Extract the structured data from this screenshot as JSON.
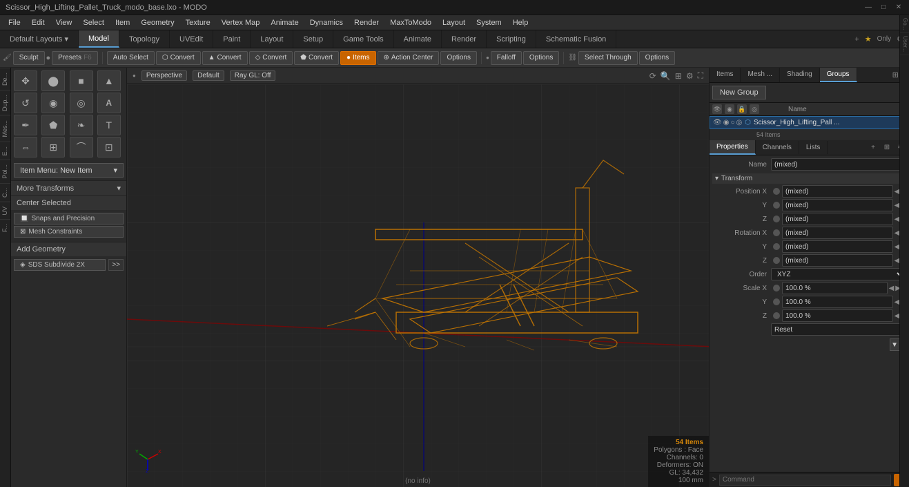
{
  "titlebar": {
    "title": "Scissor_High_Lifting_Pallet_Truck_modo_base.lxo - MODO",
    "minimize": "—",
    "maximize": "□",
    "close": "✕"
  },
  "menubar": {
    "items": [
      "File",
      "Edit",
      "View",
      "Select",
      "Item",
      "Geometry",
      "Texture",
      "Vertex Map",
      "Animate",
      "Dynamics",
      "Render",
      "MaxToModo",
      "Layout",
      "System",
      "Help"
    ]
  },
  "main_tabs": {
    "items": [
      "Default Layouts ▾",
      "Model",
      "Topology",
      "UVEdit",
      "Paint",
      "Layout",
      "Setup",
      "Game Tools",
      "Animate",
      "Render",
      "Scripting",
      "Schematic Fusion"
    ],
    "active": "Model",
    "plus": "+",
    "star": "★",
    "only_label": "Only",
    "settings_icon": "⚙"
  },
  "toolbar": {
    "sculpt": "Sculpt",
    "presets": "Presets",
    "presets_key": "F6",
    "auto_select": "Auto Select",
    "convert_1": "Convert",
    "convert_2": "Convert",
    "convert_3": "Convert",
    "convert_4": "Convert",
    "items": "Items",
    "action_center": "Action Center",
    "options_1": "Options",
    "falloff": "Falloff",
    "options_2": "Options",
    "select_through": "Select Through",
    "options_3": "Options"
  },
  "left_panel": {
    "tool_icons": [
      {
        "name": "move-tool",
        "symbol": "✥"
      },
      {
        "name": "sphere-tool",
        "symbol": "⬤"
      },
      {
        "name": "cube-tool",
        "symbol": "■"
      },
      {
        "name": "cone-tool",
        "symbol": "▲"
      },
      {
        "name": "rotate-tool",
        "symbol": "↺"
      },
      {
        "name": "torus-tool",
        "symbol": "◉"
      },
      {
        "name": "disc-tool",
        "symbol": "◎"
      },
      {
        "name": "text-tool",
        "symbol": "A"
      },
      {
        "name": "pen-tool",
        "symbol": "✒"
      },
      {
        "name": "shape-tool",
        "symbol": "⬟"
      },
      {
        "name": "drop-tool",
        "symbol": "❧"
      },
      {
        "name": "type-tool",
        "symbol": "T"
      },
      {
        "name": "mirror-tool",
        "symbol": "⇔"
      },
      {
        "name": "array-tool",
        "symbol": "⊞"
      },
      {
        "name": "bend-tool",
        "symbol": "⌒"
      },
      {
        "name": "push-tool",
        "symbol": "⊡"
      }
    ],
    "item_menu_label": "Item Menu: New Item",
    "more_transforms": "More Transforms",
    "center_selected": "Center Selected",
    "snaps_precision": "Snaps and Precision",
    "mesh_constraints": "Mesh Constraints",
    "add_geometry": "Add Geometry",
    "sds_subdivide": "SDS Subdivide 2X",
    "more_btn": ">>"
  },
  "vtabs_left": [
    "De...",
    "Dup...",
    "Mes...",
    "E...",
    "Pol...",
    "C...",
    "UV",
    "F..."
  ],
  "viewport": {
    "perspective": "Perspective",
    "default": "Default",
    "ray_gl": "Ray GL: Off",
    "items_count": "54 Items",
    "polygons": "Polygons : Face",
    "channels": "Channels: 0",
    "deformers": "Deformers: ON",
    "gl_count": "GL: 34,432",
    "size": "100 mm",
    "no_info": "(no info)"
  },
  "right_panel": {
    "tabs": [
      "Items",
      "Mesh ...",
      "Shading",
      "Groups"
    ],
    "active_tab": "Groups",
    "new_group_btn": "New Group",
    "name_header": "Name",
    "item_name": "Scissor_High_Lifting_Pall ...",
    "item_count": "54 Items",
    "expand_icon": "⊞",
    "collapse_icon": "⊟"
  },
  "properties_panel": {
    "tabs": [
      "Properties",
      "Channels",
      "Lists"
    ],
    "active_tab": "Properties",
    "plus_icon": "+",
    "name_label": "Name",
    "name_value": "(mixed)",
    "transform_section": "Transform",
    "position_x_label": "Position X",
    "position_x_value": "(mixed)",
    "position_y_label": "Y",
    "position_y_value": "(mixed)",
    "position_z_label": "Z",
    "position_z_value": "(mixed)",
    "rotation_x_label": "Rotation X",
    "rotation_x_value": "(mixed)",
    "rotation_y_label": "Y",
    "rotation_y_value": "(mixed)",
    "rotation_z_label": "Z",
    "rotation_z_value": "(mixed)",
    "order_label": "Order",
    "order_value": "XYZ",
    "scale_x_label": "Scale X",
    "scale_x_value": "100.0 %",
    "scale_y_label": "Y",
    "scale_y_value": "100.0 %",
    "scale_z_label": "Z",
    "scale_z_value": "100.0 %",
    "reset_label": "Reset",
    "command_prompt": ">",
    "command_placeholder": "Command"
  }
}
